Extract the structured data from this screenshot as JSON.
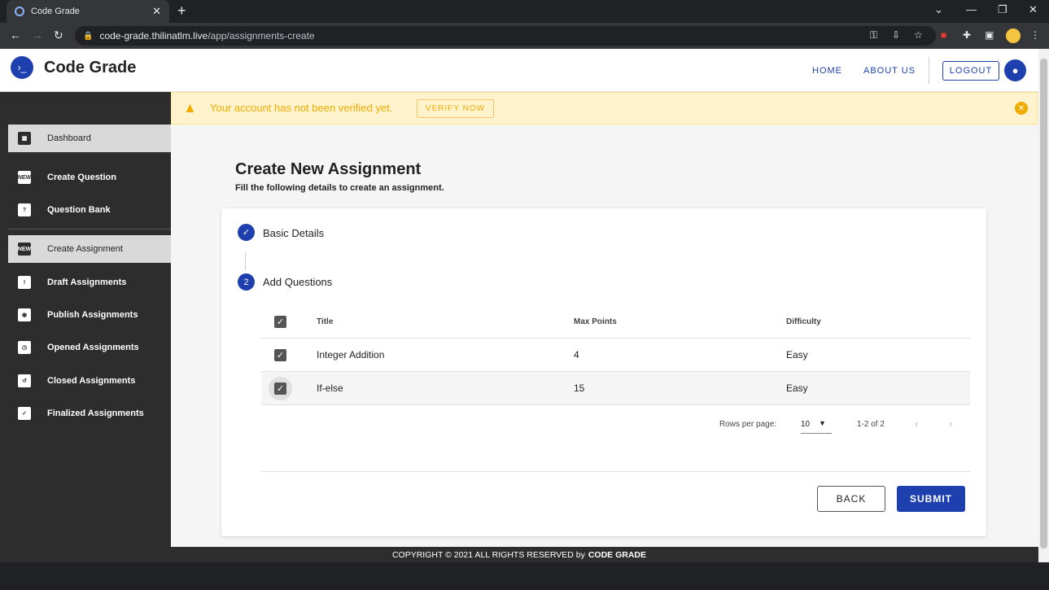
{
  "browser": {
    "tab_title": "Code Grade",
    "url_host": "code-grade.thilinatlm.live",
    "url_path": "/app/assignments-create"
  },
  "header": {
    "app_name": "Code Grade",
    "nav": [
      "HOME",
      "ABOUT US"
    ],
    "logout": "LOGOUT"
  },
  "sidebar": {
    "items": [
      {
        "label": "Dashboard",
        "icon": "dashboard-icon",
        "active": true
      },
      {
        "label": "Create Question",
        "icon": "new-icon"
      },
      {
        "label": "Question Bank",
        "icon": "question-icon"
      },
      {
        "label": "Create Assignment",
        "icon": "new-icon",
        "active": true
      },
      {
        "label": "Draft Assignments",
        "icon": "document-icon"
      },
      {
        "label": "Publish Assignments",
        "icon": "document-icon"
      },
      {
        "label": "Opened Assignments",
        "icon": "document-icon"
      },
      {
        "label": "Closed Assignments",
        "icon": "document-icon"
      },
      {
        "label": "Finalized Assignments",
        "icon": "document-icon"
      }
    ]
  },
  "alert": {
    "message": "Your account has not been verified yet.",
    "action": "VERIFY NOW",
    "color": "#f0ad00"
  },
  "main": {
    "title": "Create New Assignment",
    "subtitle": "Fill the following details to create an assignment.",
    "steps": [
      {
        "label": "Basic Details",
        "state": "completed"
      },
      {
        "label": "Add Questions",
        "number": "2",
        "state": "active"
      }
    ],
    "table": {
      "columns": [
        "Title",
        "Max Points",
        "Difficulty"
      ],
      "rows": [
        {
          "title": "Integer Addition",
          "max_points": "4",
          "difficulty": "Easy",
          "checked": true
        },
        {
          "title": "If-else",
          "max_points": "15",
          "difficulty": "Easy",
          "checked": true
        }
      ],
      "rows_per_page_label": "Rows per page:",
      "rows_per_page": "10",
      "range": "1-2 of 2"
    },
    "back": "BACK",
    "submit": "SUBMIT"
  },
  "footer": {
    "text": "COPYRIGHT © 2021 ALL RIGHTS RESERVED by",
    "brand": "CODE GRADE"
  },
  "colors": {
    "accent": "#1e40af",
    "sidebar": "#2d2d2d"
  }
}
